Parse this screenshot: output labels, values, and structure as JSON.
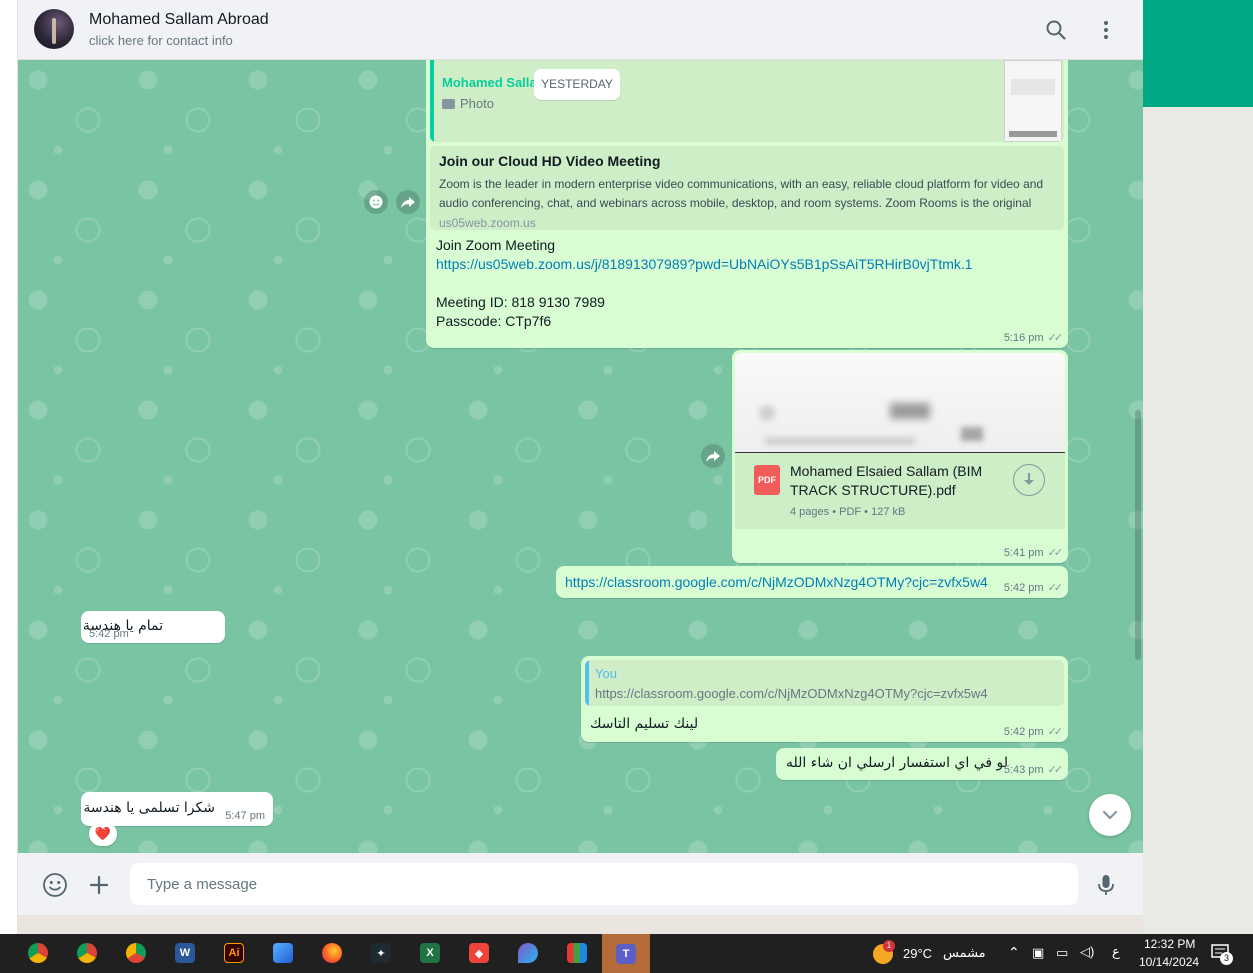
{
  "header": {
    "contact_name": "Mohamed Sallam Abroad",
    "contact_sub": "click here for contact info",
    "search_icon": "search-icon",
    "menu_icon": "kebab-menu-icon"
  },
  "date_divider": "YESTERDAY",
  "messages": {
    "zoom": {
      "quote_author": "Mohamed Sallam",
      "quote_type": "Photo",
      "preview_title": "Join our Cloud HD Video Meeting",
      "preview_desc": "Zoom is the leader in modern enterprise video communications, with an easy, reliable cloud platform for video and audio conferencing, chat, and webinars across mobile, desktop, and room systems. Zoom Rooms is the original",
      "preview_domain": "us05web.zoom.us",
      "line1": "Join Zoom Meeting",
      "link": "https://us05web.zoom.us/j/81891307989?pwd=UbNAiOYs5B1pSsAiT5RHirB0vjTtmk.1",
      "meeting_id": "Meeting ID: 818 9130 7989",
      "passcode": "Passcode: CTp7f6",
      "time": "5:16 pm"
    },
    "pdf": {
      "file_name": "Mohamed Elsaied Sallam (BIM TRACK STRUCTURE).pdf",
      "badge": "PDF",
      "meta": "4 pages • PDF • 127 kB",
      "time": "5:41 pm"
    },
    "classroom": {
      "link": "https://classroom.google.com/c/NjMzODMxNzg4OTMy?cjc=zvfx5w4",
      "time": "5:42 pm"
    },
    "reply1": {
      "text": "تمام يا هندسة",
      "time": "5:42 pm"
    },
    "quoted_reply": {
      "quote_author": "You",
      "quote_text": "https://classroom.google.com/c/NjMzODMxNzg4OTMy?cjc=zvfx5w4",
      "text": "لينك تسليم التاسك",
      "time": "5:42 pm"
    },
    "followup": {
      "text": "لو في اي استفسار ارسلي ان شاء الله",
      "time": "5:43 pm"
    },
    "reply2": {
      "text": "شكرا تسلمى يا هندسة",
      "time": "5:47 pm",
      "reaction": "❤️"
    }
  },
  "composer": {
    "placeholder": "Type a message",
    "emoji_icon": "emoji-icon",
    "attach_icon": "plus-icon",
    "mic_icon": "mic-icon"
  },
  "taskbar": {
    "weather_badge": "1",
    "temperature": "29°C",
    "weather_label": "مشمس",
    "language": "ع",
    "time": "12:32 PM",
    "date": "10/14/2024",
    "notification_count": "3",
    "apps": [
      "chrome-profile",
      "chrome",
      "chrome-alt",
      "word",
      "illustrator",
      "photos",
      "firefox",
      "capcut",
      "excel",
      "anydesk",
      "paint",
      "paint-tool",
      "teams"
    ]
  },
  "colors": {
    "chat_bg": "#79c4a2",
    "outgoing_bubble": "#d9fdd3",
    "incoming_bubble": "#ffffff",
    "accent": "#00a884",
    "link": "#027eb5"
  }
}
